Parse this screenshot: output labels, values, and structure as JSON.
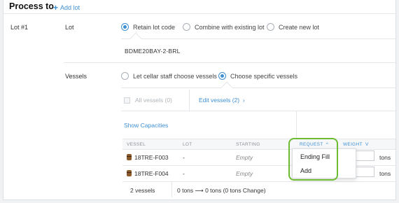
{
  "header": {
    "title": "Process to",
    "add_lot": "Add lot"
  },
  "lot": {
    "label": "Lot #1",
    "row_label": "Lot",
    "options": [
      "Retain lot code",
      "Combine with existing lot",
      "Create new lot"
    ],
    "selected_option": "Retain lot code",
    "lot_code": "BDME20BAY-2-BRL"
  },
  "vessels": {
    "row_label": "Vessels",
    "options": [
      "Let cellar staff choose vessels",
      "Choose specific vessels"
    ],
    "selected_option": "Choose specific vessels",
    "all_vessels": "All vessels (0)",
    "edit_vessels": "Edit vessels (2)",
    "edit_vessels_chevron": "›",
    "show_capacities": "Show Capacities"
  },
  "table": {
    "columns": [
      "VESSEL",
      "LOT",
      "STARTING",
      "REQUEST",
      "WEIGHT"
    ],
    "sort_arrows": {
      "request": "^",
      "weight": "v"
    },
    "rows": [
      {
        "vessel": "18TRE-F003",
        "lot": "-",
        "starting": "Empty",
        "weight_unit": "tons"
      },
      {
        "vessel": "18TRE-F004",
        "lot": "-",
        "starting": "Empty",
        "weight_unit": "tons"
      }
    ],
    "footer": {
      "count": "2 vessels",
      "summary": "0 tons ⟶ 0 tons (0 tons Change)"
    }
  },
  "request_dropdown": {
    "options": [
      "Ending Fill",
      "Add"
    ]
  },
  "colors": {
    "accent": "#3f8fd2",
    "highlight": "#6dbb33",
    "barrel": "#8a5a2b"
  },
  "icons": [
    "plus-icon",
    "barrel-icon",
    "chevron-right-icon"
  ]
}
